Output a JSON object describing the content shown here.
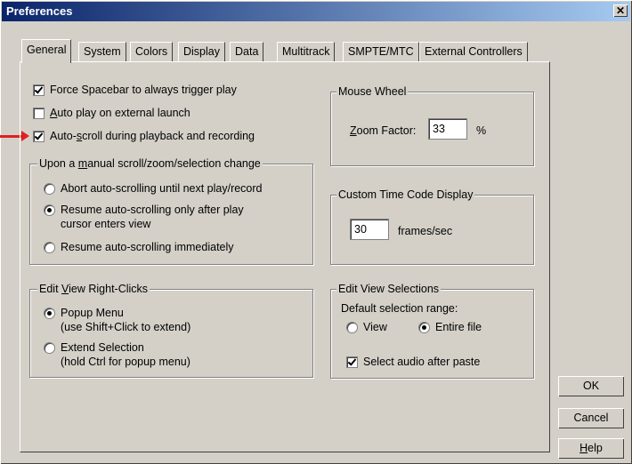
{
  "window": {
    "title": "Preferences",
    "close_label": "✕"
  },
  "tabs": [
    {
      "label": "General",
      "active": true
    },
    {
      "label": "System"
    },
    {
      "label": "Colors"
    },
    {
      "label": "Display"
    },
    {
      "label": "Data"
    },
    {
      "label": "Multitrack"
    },
    {
      "label": "SMPTE/MTC"
    },
    {
      "label": "External Controllers"
    }
  ],
  "general": {
    "force_spacebar": {
      "label": "Force Spacebar to always trigger play",
      "checked": true
    },
    "auto_play": {
      "pre": "",
      "u": "A",
      "post": "uto play on external launch",
      "checked": false
    },
    "auto_scroll": {
      "pre": "Auto-",
      "u": "s",
      "post": "croll during playback and recording",
      "checked": true
    },
    "scroll_group": {
      "title_pre": "Upon a ",
      "title_u": "m",
      "title_post": "anual scroll/zoom/selection change",
      "options": [
        {
          "label": "Abort auto-scrolling until next play/record",
          "checked": false
        },
        {
          "line1": "Resume auto-scrolling only after play",
          "line2": "cursor enters view",
          "checked": true
        },
        {
          "label": "Resume auto-scrolling immediately",
          "checked": false
        }
      ]
    },
    "right_click_group": {
      "title_pre": "Edit ",
      "title_u": "V",
      "title_post": "iew Right-Clicks",
      "options": [
        {
          "line1": "Popup Menu",
          "line2": "(use Shift+Click to extend)",
          "checked": true
        },
        {
          "line1": "Extend Selection",
          "line2": "(hold Ctrl for popup menu)",
          "checked": false
        }
      ]
    },
    "mouse_wheel_group": {
      "title": "Mouse Wheel",
      "zoom_pre": "",
      "zoom_u": "Z",
      "zoom_post": "oom Factor:",
      "zoom_value": "33",
      "zoom_unit": "%"
    },
    "time_code_group": {
      "title": "Custom Time Code Display",
      "frames_value": "30",
      "frames_unit": "frames/sec"
    },
    "selections_group": {
      "title": "Edit View Selections",
      "default_label": "Default selection range:",
      "view_option": {
        "label": "View",
        "checked": false
      },
      "entire_option": {
        "label": "Entire file",
        "checked": true
      },
      "select_audio": {
        "label": "Select audio after paste",
        "checked": true
      }
    }
  },
  "buttons": {
    "ok": "OK",
    "cancel": "Cancel",
    "help_u": "H",
    "help_post": "elp"
  },
  "colors": {
    "title_bar_start": "#0a246a",
    "title_bar_end": "#a6caf0",
    "face": "#d4d0c8",
    "arrow": "#e02020"
  }
}
